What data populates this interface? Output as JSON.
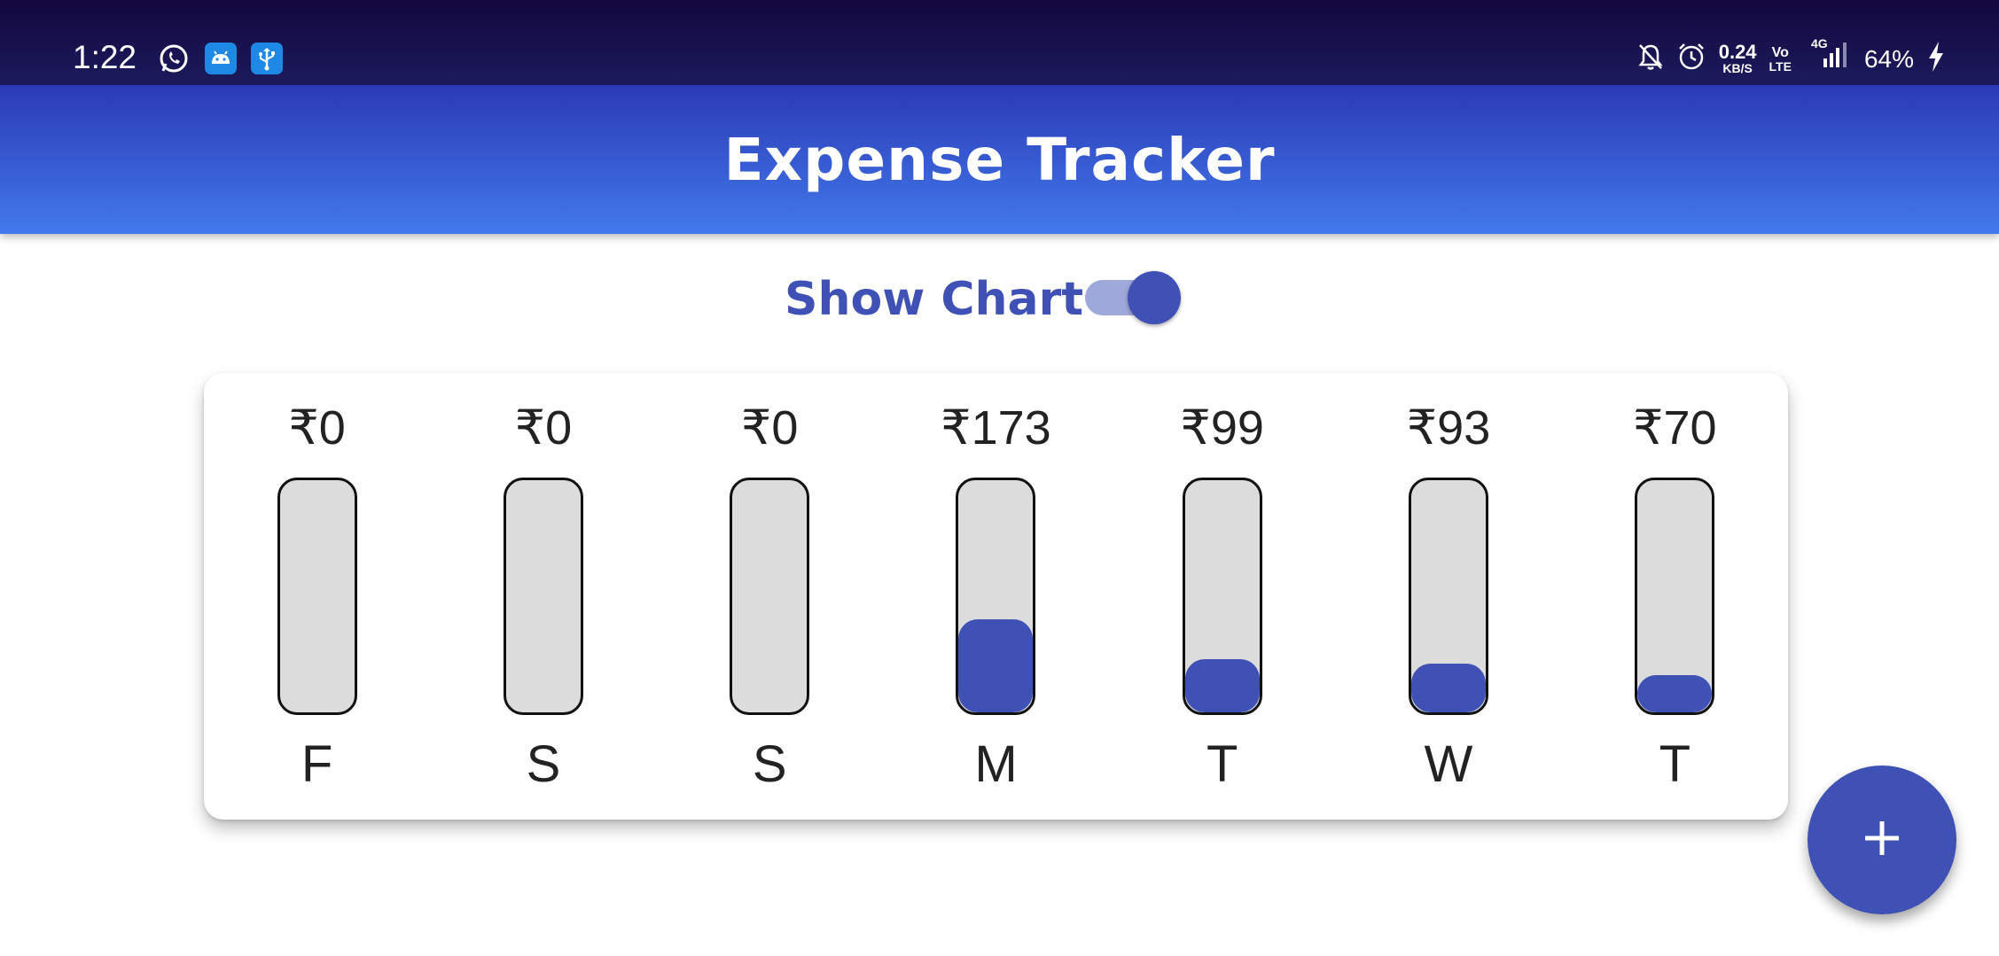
{
  "status_bar": {
    "time": "1:22",
    "left_icons": [
      "whatsapp-icon",
      "android-icon",
      "usb-icon"
    ],
    "data_speed_value": "0.24",
    "data_speed_unit": "KB/S",
    "volte_top": "Vo",
    "volte_bottom": "LTE",
    "network": "4G",
    "battery": "64%",
    "right_icons": [
      "bell-off-icon",
      "alarm-icon",
      "signal-icon",
      "charging-icon"
    ]
  },
  "app_bar": {
    "title": "Expense Tracker"
  },
  "toggle": {
    "label": "Show Chart",
    "on": true
  },
  "chart_data": {
    "type": "bar",
    "categories": [
      "F",
      "S",
      "S",
      "M",
      "T",
      "W",
      "T"
    ],
    "labels": [
      "₹0",
      "₹0",
      "₹0",
      "₹173",
      "₹99",
      "₹93",
      "₹70"
    ],
    "values": [
      0,
      0,
      0,
      173,
      99,
      93,
      70
    ],
    "fill_fraction": [
      0,
      0,
      0,
      0.4,
      0.23,
      0.21,
      0.16
    ]
  },
  "fab": {
    "label": "+",
    "icon": "add-icon"
  },
  "colors": {
    "primary": "#3f51b5",
    "appbar_top": "#2b3ab5",
    "appbar_bottom": "#4279ec",
    "statusbar": "#13073f",
    "bar_track": "#dcdcdc"
  }
}
